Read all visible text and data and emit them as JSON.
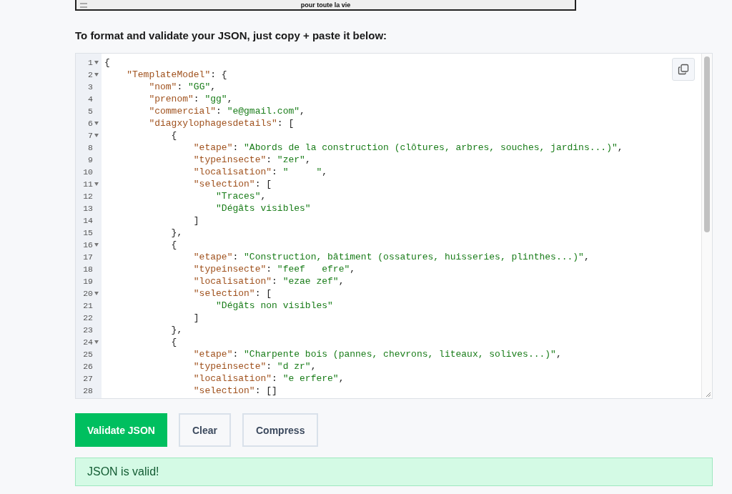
{
  "top_panel": {
    "caption": "pour toute la vie"
  },
  "heading": "To format and validate your JSON, just copy + paste it below:",
  "editor": {
    "lines": [
      {
        "number": "1",
        "foldable": true,
        "tokens": [
          {
            "kind": "plain",
            "text": "{"
          }
        ]
      },
      {
        "number": "2",
        "foldable": true,
        "tokens": [
          {
            "kind": "key",
            "text": "    \"TemplateModel\""
          },
          {
            "kind": "plain",
            "text": ": {"
          }
        ]
      },
      {
        "number": "3",
        "foldable": false,
        "tokens": [
          {
            "kind": "key",
            "text": "        \"nom\""
          },
          {
            "kind": "plain",
            "text": ": "
          },
          {
            "kind": "string",
            "text": "\"GG\""
          },
          {
            "kind": "plain",
            "text": ","
          }
        ]
      },
      {
        "number": "4",
        "foldable": false,
        "tokens": [
          {
            "kind": "key",
            "text": "        \"prenom\""
          },
          {
            "kind": "plain",
            "text": ": "
          },
          {
            "kind": "string",
            "text": "\"gg\""
          },
          {
            "kind": "plain",
            "text": ","
          }
        ]
      },
      {
        "number": "5",
        "foldable": false,
        "tokens": [
          {
            "kind": "key",
            "text": "        \"commercial\""
          },
          {
            "kind": "plain",
            "text": ": "
          },
          {
            "kind": "string",
            "text": "\"e@gmail.com\""
          },
          {
            "kind": "plain",
            "text": ","
          }
        ]
      },
      {
        "number": "6",
        "foldable": true,
        "tokens": [
          {
            "kind": "key",
            "text": "        \"diagxylophagesdetails\""
          },
          {
            "kind": "plain",
            "text": ": ["
          }
        ]
      },
      {
        "number": "7",
        "foldable": true,
        "tokens": [
          {
            "kind": "plain",
            "text": "            {"
          }
        ]
      },
      {
        "number": "8",
        "foldable": false,
        "tokens": [
          {
            "kind": "key",
            "text": "                \"etape\""
          },
          {
            "kind": "plain",
            "text": ": "
          },
          {
            "kind": "string",
            "text": "\"Abords de la construction (clôtures, arbres, souches, jardins...)\""
          },
          {
            "kind": "plain",
            "text": ","
          }
        ]
      },
      {
        "number": "9",
        "foldable": false,
        "tokens": [
          {
            "kind": "key",
            "text": "                \"typeinsecte\""
          },
          {
            "kind": "plain",
            "text": ": "
          },
          {
            "kind": "string",
            "text": "\"zer\""
          },
          {
            "kind": "plain",
            "text": ","
          }
        ]
      },
      {
        "number": "10",
        "foldable": false,
        "tokens": [
          {
            "kind": "key",
            "text": "                \"localisation\""
          },
          {
            "kind": "plain",
            "text": ": "
          },
          {
            "kind": "string",
            "text": "\"     \""
          },
          {
            "kind": "plain",
            "text": ","
          }
        ]
      },
      {
        "number": "11",
        "foldable": true,
        "tokens": [
          {
            "kind": "key",
            "text": "                \"selection\""
          },
          {
            "kind": "plain",
            "text": ": ["
          }
        ]
      },
      {
        "number": "12",
        "foldable": false,
        "tokens": [
          {
            "kind": "string",
            "text": "                    \"Traces\""
          },
          {
            "kind": "plain",
            "text": ","
          }
        ]
      },
      {
        "number": "13",
        "foldable": false,
        "tokens": [
          {
            "kind": "string",
            "text": "                    \"Dégâts visibles\""
          }
        ]
      },
      {
        "number": "14",
        "foldable": false,
        "tokens": [
          {
            "kind": "plain",
            "text": "                ]"
          }
        ]
      },
      {
        "number": "15",
        "foldable": false,
        "tokens": [
          {
            "kind": "plain",
            "text": "            },"
          }
        ]
      },
      {
        "number": "16",
        "foldable": true,
        "tokens": [
          {
            "kind": "plain",
            "text": "            {"
          }
        ]
      },
      {
        "number": "17",
        "foldable": false,
        "tokens": [
          {
            "kind": "key",
            "text": "                \"etape\""
          },
          {
            "kind": "plain",
            "text": ": "
          },
          {
            "kind": "string",
            "text": "\"Construction, bâtiment (ossatures, huisseries, plinthes...)\""
          },
          {
            "kind": "plain",
            "text": ","
          }
        ]
      },
      {
        "number": "18",
        "foldable": false,
        "tokens": [
          {
            "kind": "key",
            "text": "                \"typeinsecte\""
          },
          {
            "kind": "plain",
            "text": ": "
          },
          {
            "kind": "string",
            "text": "\"feef   efre\""
          },
          {
            "kind": "plain",
            "text": ","
          }
        ]
      },
      {
        "number": "19",
        "foldable": false,
        "tokens": [
          {
            "kind": "key",
            "text": "                \"localisation\""
          },
          {
            "kind": "plain",
            "text": ": "
          },
          {
            "kind": "string",
            "text": "\"ezae zef\""
          },
          {
            "kind": "plain",
            "text": ","
          }
        ]
      },
      {
        "number": "20",
        "foldable": true,
        "tokens": [
          {
            "kind": "key",
            "text": "                \"selection\""
          },
          {
            "kind": "plain",
            "text": ": ["
          }
        ]
      },
      {
        "number": "21",
        "foldable": false,
        "tokens": [
          {
            "kind": "string",
            "text": "                    \"Dégâts non visibles\""
          }
        ]
      },
      {
        "number": "22",
        "foldable": false,
        "tokens": [
          {
            "kind": "plain",
            "text": "                ]"
          }
        ]
      },
      {
        "number": "23",
        "foldable": false,
        "tokens": [
          {
            "kind": "plain",
            "text": "            },"
          }
        ]
      },
      {
        "number": "24",
        "foldable": true,
        "tokens": [
          {
            "kind": "plain",
            "text": "            {"
          }
        ]
      },
      {
        "number": "25",
        "foldable": false,
        "tokens": [
          {
            "kind": "key",
            "text": "                \"etape\""
          },
          {
            "kind": "plain",
            "text": ": "
          },
          {
            "kind": "string",
            "text": "\"Charpente bois (pannes, chevrons, liteaux, solives...)\""
          },
          {
            "kind": "plain",
            "text": ","
          }
        ]
      },
      {
        "number": "26",
        "foldable": false,
        "tokens": [
          {
            "kind": "key",
            "text": "                \"typeinsecte\""
          },
          {
            "kind": "plain",
            "text": ": "
          },
          {
            "kind": "string",
            "text": "\"d zr\""
          },
          {
            "kind": "plain",
            "text": ","
          }
        ]
      },
      {
        "number": "27",
        "foldable": false,
        "tokens": [
          {
            "kind": "key",
            "text": "                \"localisation\""
          },
          {
            "kind": "plain",
            "text": ": "
          },
          {
            "kind": "string",
            "text": "\"e erfere\""
          },
          {
            "kind": "plain",
            "text": ","
          }
        ]
      },
      {
        "number": "28",
        "foldable": false,
        "tokens": [
          {
            "kind": "key",
            "text": "                \"selection\""
          },
          {
            "kind": "plain",
            "text": ": []"
          }
        ]
      }
    ]
  },
  "buttons": [
    {
      "label": "Validate JSON",
      "kind": "primary"
    },
    {
      "label": "Clear",
      "kind": "secondary"
    },
    {
      "label": "Compress",
      "kind": "secondary"
    }
  ],
  "result": {
    "message": "JSON is valid!",
    "kind": "success"
  }
}
